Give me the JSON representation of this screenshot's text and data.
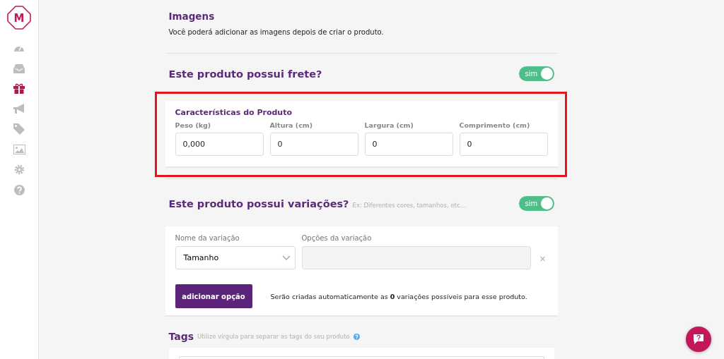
{
  "sidebar": {
    "logo": "M",
    "items": [
      {
        "kind": "dashboard",
        "selected": false
      },
      {
        "kind": "inbox",
        "selected": false
      },
      {
        "kind": "gift",
        "selected": true
      },
      {
        "kind": "megaphone",
        "selected": false
      },
      {
        "kind": "tag",
        "selected": false
      },
      {
        "kind": "image",
        "selected": false
      },
      {
        "kind": "gear",
        "selected": false
      },
      {
        "kind": "help",
        "selected": false
      }
    ]
  },
  "images": {
    "title": "Imagens",
    "text": "Você poderá adicionar as imagens depois de criar o produto."
  },
  "shipping": {
    "title": "Este produto possui frete?",
    "toggle": {
      "label": "sim",
      "on": true
    },
    "highlighted": true,
    "card_title": "Características do Produto",
    "fields": [
      {
        "label": "Peso (kg)",
        "value": "0,000"
      },
      {
        "label": "Altura (cm)",
        "value": "0"
      },
      {
        "label": "Largura (cm)",
        "value": "0"
      },
      {
        "label": "Comprimento (cm)",
        "value": "0"
      }
    ]
  },
  "variations": {
    "title": "Este produto possui variações?",
    "hint": "Ex: Diferentes cores, tamanhos, etc...",
    "toggle": {
      "label": "sim",
      "on": true
    },
    "name_label": "Nome da variação",
    "name_value": "Tamanho",
    "options_label": "Opções da variação",
    "remove": "×",
    "add_button": "adicionar opção",
    "summary": "Serão criadas automaticamente as **0** variações possíveis para esse produto."
  },
  "tags": {
    "title": "Tags",
    "hint": "Utilize vírgula para separar as tags do seu produto"
  }
}
